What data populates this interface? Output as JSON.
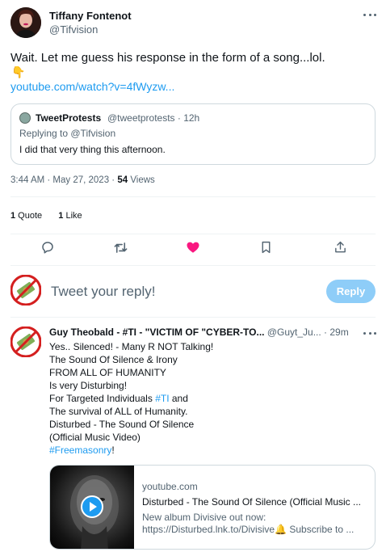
{
  "main_tweet": {
    "author_name": "Tiffany Fontenot",
    "author_handle": "@Tifvision",
    "text": "Wait. Let me guess his response in the form of a song...lol.",
    "emoji": "👇",
    "link": "youtube.com/watch?v=4fWyzw...",
    "timestamp": "3:44 AM · May 27, 2023 · ",
    "views_count": "54",
    "views_label": " Views"
  },
  "quoted_tweet": {
    "name": "TweetProtests",
    "handle_time": "@tweetprotests · 12h",
    "replying_label": "Replying to ",
    "replying_handle": "@Tifvision",
    "text": "I did that very thing this afternoon."
  },
  "stats": {
    "quote_count": "1",
    "quote_label": " Quote",
    "like_count": "1",
    "like_label": " Like"
  },
  "actions": {
    "reply_icon": "reply-icon",
    "retweet_icon": "retweet-icon",
    "like_icon": "heart-filled-icon",
    "bookmark_icon": "bookmark-icon",
    "share_icon": "share-icon",
    "like_color": "#f91880"
  },
  "composer": {
    "placeholder": "Tweet your reply!",
    "reply_button": "Reply"
  },
  "reply": {
    "author_name": "Guy Theobald - #TI - \"VICTIM OF \"CYBER-TO...",
    "author_handle": "@Guyt_Ju...",
    "time": " · 29m",
    "lines": [
      "Yes.. Silenced! - Many R NOT Talking!",
      "The Sound Of Silence & Irony",
      "FROM ALL OF HUMANITY",
      "Is very Disturbing!"
    ],
    "line5_pre": "For Targeted Individuals ",
    "line5_tag": "#TI",
    "line5_post": " and",
    "lines_after": [
      "The survival of ALL of Humanity.",
      "Disturbed  - The Sound Of Silence",
      "(Official Music Video)"
    ],
    "hashtag": "#Freemasonry",
    "hashtag_after": "!"
  },
  "link_card": {
    "domain": "youtube.com",
    "title": "Disturbed - The Sound Of Silence (Official Music ...",
    "desc1": "New album Divisive out now:",
    "desc2": "https://Disturbed.lnk.to/Divisive🔔 Subscribe to ..."
  },
  "colors": {
    "accent": "#1d9bf0",
    "reply_button_disabled": "#8ecdf8",
    "muted": "#536471"
  }
}
